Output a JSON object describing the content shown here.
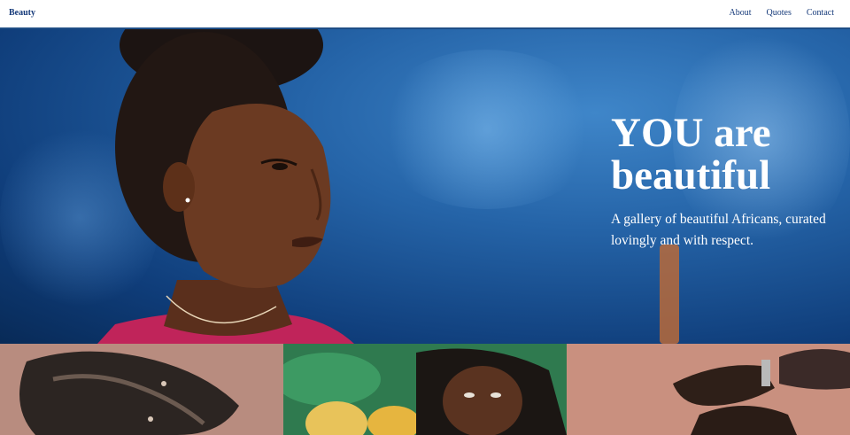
{
  "nav": {
    "brand": "Beauty",
    "links": [
      "About",
      "Quotes",
      "Contact"
    ]
  },
  "hero": {
    "title_line1": "YOU are",
    "title_line2": "beautiful",
    "subtitle": "A gallery of beautiful Africans, curated lovingly and with respect."
  },
  "colors": {
    "nav_text": "#163a7a",
    "nav_border": "#1f4e86",
    "hero_blue": "#2564a8",
    "hero_text": "#ffffff"
  }
}
